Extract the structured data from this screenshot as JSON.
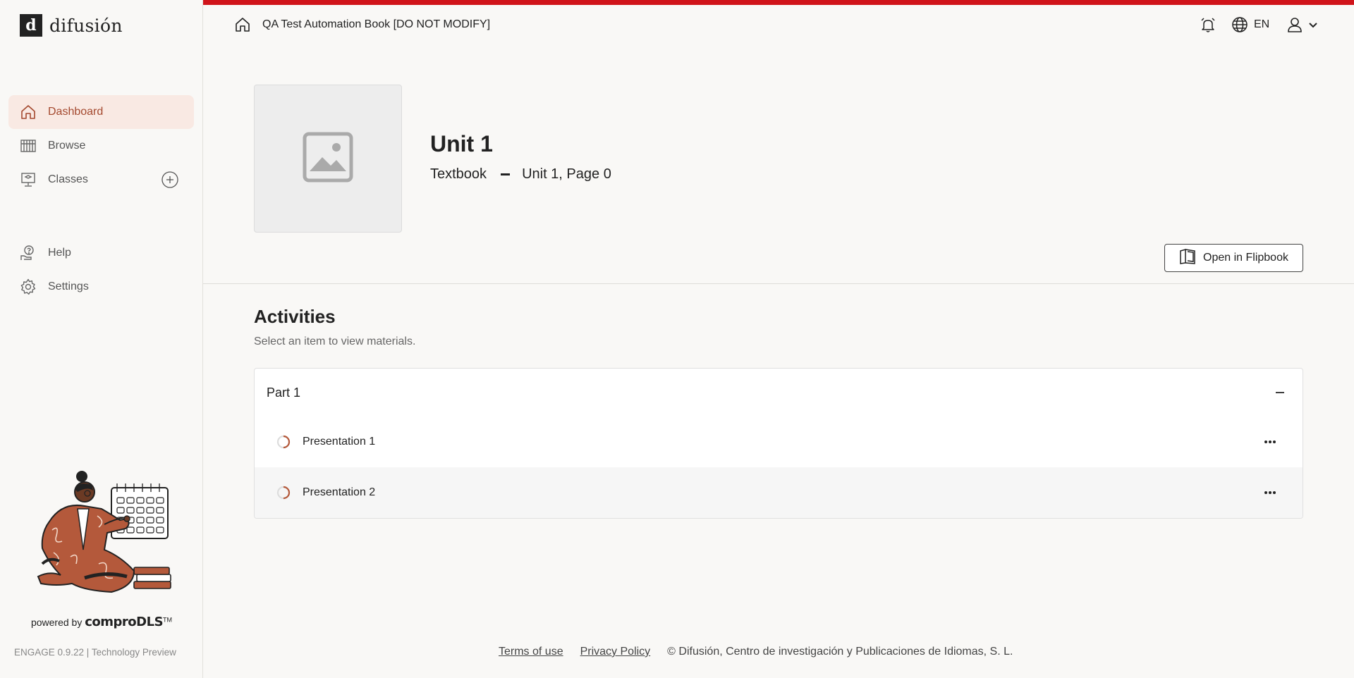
{
  "brand": {
    "name": "difusión",
    "mark": "d"
  },
  "sidebar": {
    "items": [
      {
        "label": "Dashboard",
        "icon": "home-icon",
        "active": true
      },
      {
        "label": "Browse",
        "icon": "books-icon"
      },
      {
        "label": "Classes",
        "icon": "classroom-icon"
      }
    ],
    "secondary": [
      {
        "label": "Help",
        "icon": "help-icon"
      },
      {
        "label": "Settings",
        "icon": "gear-icon"
      }
    ],
    "powered_by": "powered by",
    "powered_brand": "comproDLS",
    "trademark": "TM",
    "version": "ENGAGE 0.9.22 | Technology Preview"
  },
  "topbar": {
    "book_title": "QA Test Automation Book [DO NOT MODIFY]",
    "language": "EN",
    "accent_color": "#d0141a"
  },
  "unit": {
    "title": "Unit 1",
    "type": "Textbook",
    "location": "Unit 1, Page 0",
    "open_button": "Open in Flipbook"
  },
  "activities": {
    "title": "Activities",
    "subtitle": "Select an item to view materials.",
    "part": {
      "label": "Part 1",
      "expanded": true
    },
    "items": [
      {
        "label": "Presentation 1"
      },
      {
        "label": "Presentation 2"
      }
    ]
  },
  "footer": {
    "terms": "Terms of use",
    "privacy": "Privacy Policy",
    "copyright": "© Difusión, Centro de investigación y Publicaciones de Idiomas, S. L."
  },
  "colors": {
    "active_nav_bg": "#f9e9e3",
    "active_nav_text": "#a4492f",
    "accent": "#d0141a"
  }
}
